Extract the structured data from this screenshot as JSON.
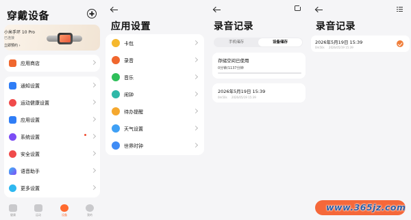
{
  "panel1": {
    "title": "穿戴设备",
    "device": {
      "name": "小米手环 10 Pro",
      "status": "已连接",
      "link": "立即预约 ›"
    },
    "store_item": {
      "label": "应用商店",
      "color": "#f0672e"
    },
    "settings_items": [
      {
        "label": "通知设置",
        "color": "#2f7df6",
        "icon": "bell-icon"
      },
      {
        "label": "运动健康设置",
        "color": "#f04b4b",
        "icon": "heart-icon"
      },
      {
        "label": "应用设置",
        "color": "#2f7df6",
        "icon": "grid-icon"
      },
      {
        "label": "系统设置",
        "color": "#7c4df5",
        "icon": "gear-icon",
        "badge": true
      },
      {
        "label": "安全设置",
        "color": "#f04b4b",
        "icon": "shield-icon"
      },
      {
        "label": "语音助手",
        "color": "#3fb8f5",
        "icon": "assistant-icon"
      },
      {
        "label": "更多设置",
        "color": "#2fb8f0",
        "icon": "more-icon"
      }
    ],
    "tabs": [
      {
        "label": "健康",
        "active": false
      },
      {
        "label": "运动",
        "active": false
      },
      {
        "label": "设备",
        "active": true
      },
      {
        "label": "我的",
        "active": false
      }
    ]
  },
  "panel2": {
    "title": "应用设置",
    "items": [
      {
        "label": "卡包",
        "color": "#f5b82e",
        "icon": "wallet-icon"
      },
      {
        "label": "录音",
        "color": "#f0672e",
        "icon": "recorder-icon"
      },
      {
        "label": "音乐",
        "color": "#2fbf5a",
        "icon": "music-icon"
      },
      {
        "label": "闹钟",
        "color": "#2fb8a8",
        "icon": "alarm-icon"
      },
      {
        "label": "待办提醒",
        "color": "#f5a82e",
        "icon": "todo-icon"
      },
      {
        "label": "天气设置",
        "color": "#3fa0f5",
        "icon": "weather-icon"
      },
      {
        "label": "世界时钟",
        "color": "#3f8cf5",
        "icon": "world-clock-icon"
      }
    ]
  },
  "panel3": {
    "title": "录音记录",
    "segments": [
      {
        "label": "手机储存",
        "selected": false
      },
      {
        "label": "设备储存",
        "selected": true
      }
    ],
    "storage": {
      "title": "存储空间已使用",
      "value_text": "0分钟/1137分钟",
      "used_fraction": 0.0
    },
    "record": {
      "title": "2026年5月19日 15:39",
      "duration": "0m50s",
      "date": "2026/05/19 15:39"
    }
  },
  "panel4": {
    "title": "录音记录",
    "record": {
      "title": "2026年5月19日 15:39",
      "duration": "0m50s",
      "date": "2026/05/19 15:39",
      "checked": true
    },
    "watermark": "www.365jz.com",
    "accent": "#f5683a"
  }
}
